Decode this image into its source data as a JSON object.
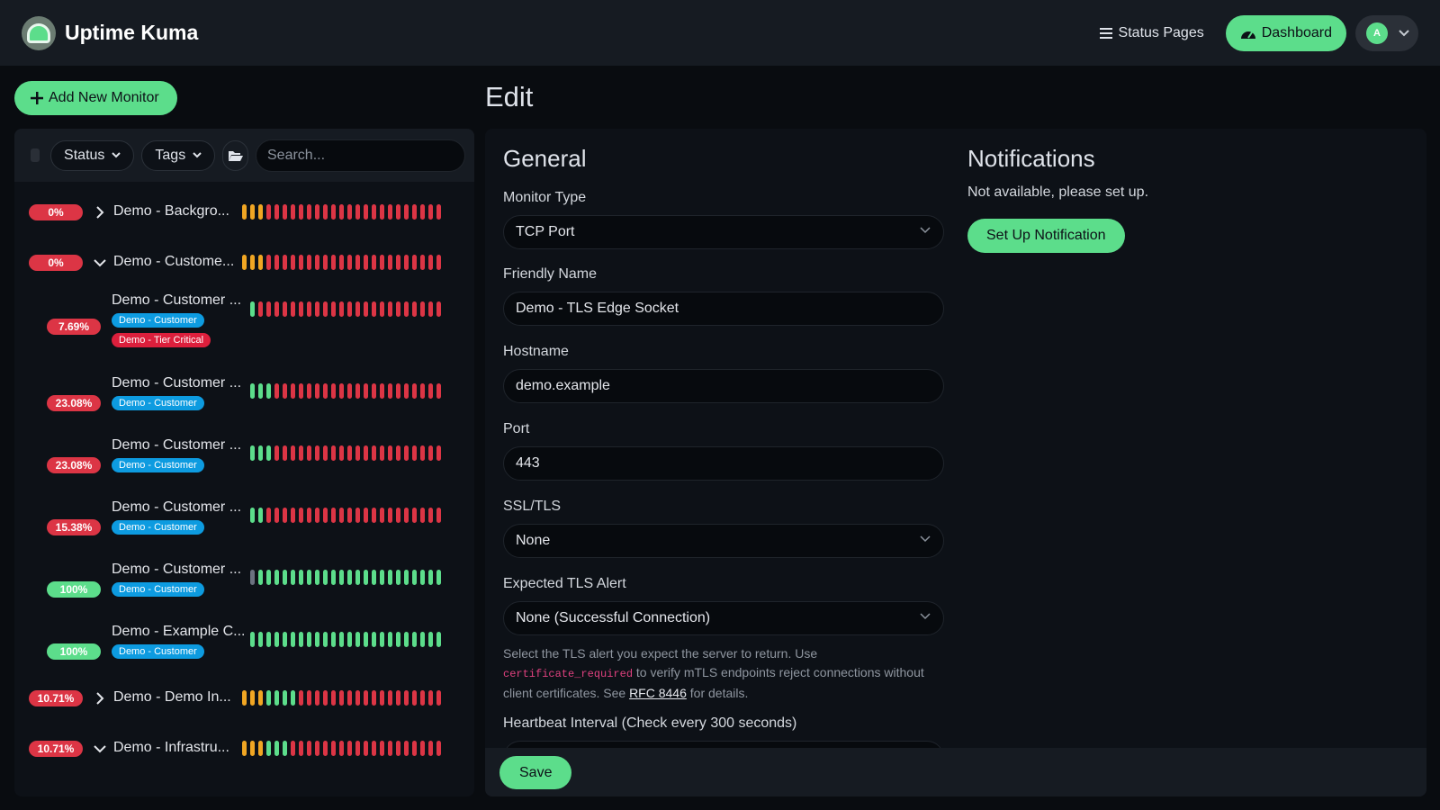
{
  "app": {
    "title": "Uptime Kuma"
  },
  "header": {
    "status_pages": "Status Pages",
    "dashboard": "Dashboard",
    "avatar_letter": "A"
  },
  "sidebar": {
    "add_button": "Add New Monitor",
    "filters": {
      "status": "Status",
      "tags": "Tags"
    },
    "search_placeholder": "Search...",
    "monitors": [
      {
        "pct": "0%",
        "name": "Demo - Backgro...",
        "expand": "collapsed",
        "color": "#dc3545",
        "beats": "yyyrrrrrrrrrrrrrrrrrrrrrr",
        "tags": []
      },
      {
        "pct": "0%",
        "name": "Demo - Custome...",
        "expand": "expanded",
        "color": "#dc3545",
        "beats": "yyyrrrrrrrrrrrrrrrrrrrrrr",
        "tags": []
      },
      {
        "pct": "7.69%",
        "name": "Demo - Customer ...",
        "expand": "child",
        "color": "#dc3545",
        "beats": "grrrrrrrrrrrrrrrrrrrrrrr",
        "tags": [
          {
            "text": "Demo - Customer",
            "color": "#0d9be0"
          },
          {
            "text": "Demo - Tier Critical",
            "color": "#dc1f3c"
          }
        ]
      },
      {
        "pct": "23.08%",
        "name": "Demo - Customer ...",
        "expand": "child",
        "color": "#dc3545",
        "beats": "gggrrrrrrrrrrrrrrrrrrrrr",
        "tags": [
          {
            "text": "Demo - Customer",
            "color": "#0d9be0"
          }
        ]
      },
      {
        "pct": "23.08%",
        "name": "Demo - Customer ...",
        "expand": "child",
        "color": "#dc3545",
        "beats": "gggrrrrrrrrrrrrrrrrrrrrr",
        "tags": [
          {
            "text": "Demo - Customer",
            "color": "#0d9be0"
          }
        ]
      },
      {
        "pct": "15.38%",
        "name": "Demo - Customer ...",
        "expand": "child",
        "color": "#dc3545",
        "beats": "ggrrrrrrrrrrrrrrrrrrrrrr",
        "tags": [
          {
            "text": "Demo - Customer",
            "color": "#0d9be0"
          }
        ]
      },
      {
        "pct": "100%",
        "name": "Demo - Customer ...",
        "expand": "child",
        "color": "#5cdd8b",
        "beats": "nggggggggggggggggggggggg",
        "tags": [
          {
            "text": "Demo - Customer",
            "color": "#0d9be0"
          }
        ]
      },
      {
        "pct": "100%",
        "name": "Demo - Example C...",
        "expand": "child",
        "color": "#5cdd8b",
        "beats": "gggggggggggggggggggggggg",
        "tags": [
          {
            "text": "Demo - Customer",
            "color": "#0d9be0"
          }
        ]
      },
      {
        "pct": "10.71%",
        "name": "Demo - Demo In...",
        "expand": "collapsed",
        "color": "#dc3545",
        "beats": "yyyggggrrrrrrrrrrrrrrrrrr",
        "tags": []
      },
      {
        "pct": "10.71%",
        "name": "Demo - Infrastru...",
        "expand": "expanded",
        "color": "#dc3545",
        "beats": "yyygggrrrrrrrrrrrrrrrrrrr",
        "tags": []
      }
    ]
  },
  "main": {
    "title": "Edit",
    "general": {
      "heading": "General",
      "monitor_type_label": "Monitor Type",
      "monitor_type_value": "TCP Port",
      "friendly_name_label": "Friendly Name",
      "friendly_name_value": "Demo - TLS Edge Socket",
      "hostname_label": "Hostname",
      "hostname_value": "demo.example",
      "port_label": "Port",
      "port_value": "443",
      "ssl_label": "SSL/TLS",
      "ssl_value": "None",
      "tls_alert_label": "Expected TLS Alert",
      "tls_alert_value": "None (Successful Connection)",
      "help_part1": "Select the TLS alert you expect the server to return. Use ",
      "help_code": "certificate_required",
      "help_part2": " to verify mTLS endpoints reject connections without client certificates. See ",
      "help_link": "RFC 8446",
      "help_part3": " for details.",
      "heartbeat_label": "Heartbeat Interval (Check every 300 seconds)"
    },
    "notifications": {
      "heading": "Notifications",
      "text": "Not available, please set up.",
      "setup_button": "Set Up Notification"
    },
    "save_button": "Save"
  },
  "colors": {
    "accent": "#5cdd8b",
    "danger": "#dc3545",
    "warning": "#f0a623",
    "muted": "#6b7280"
  }
}
